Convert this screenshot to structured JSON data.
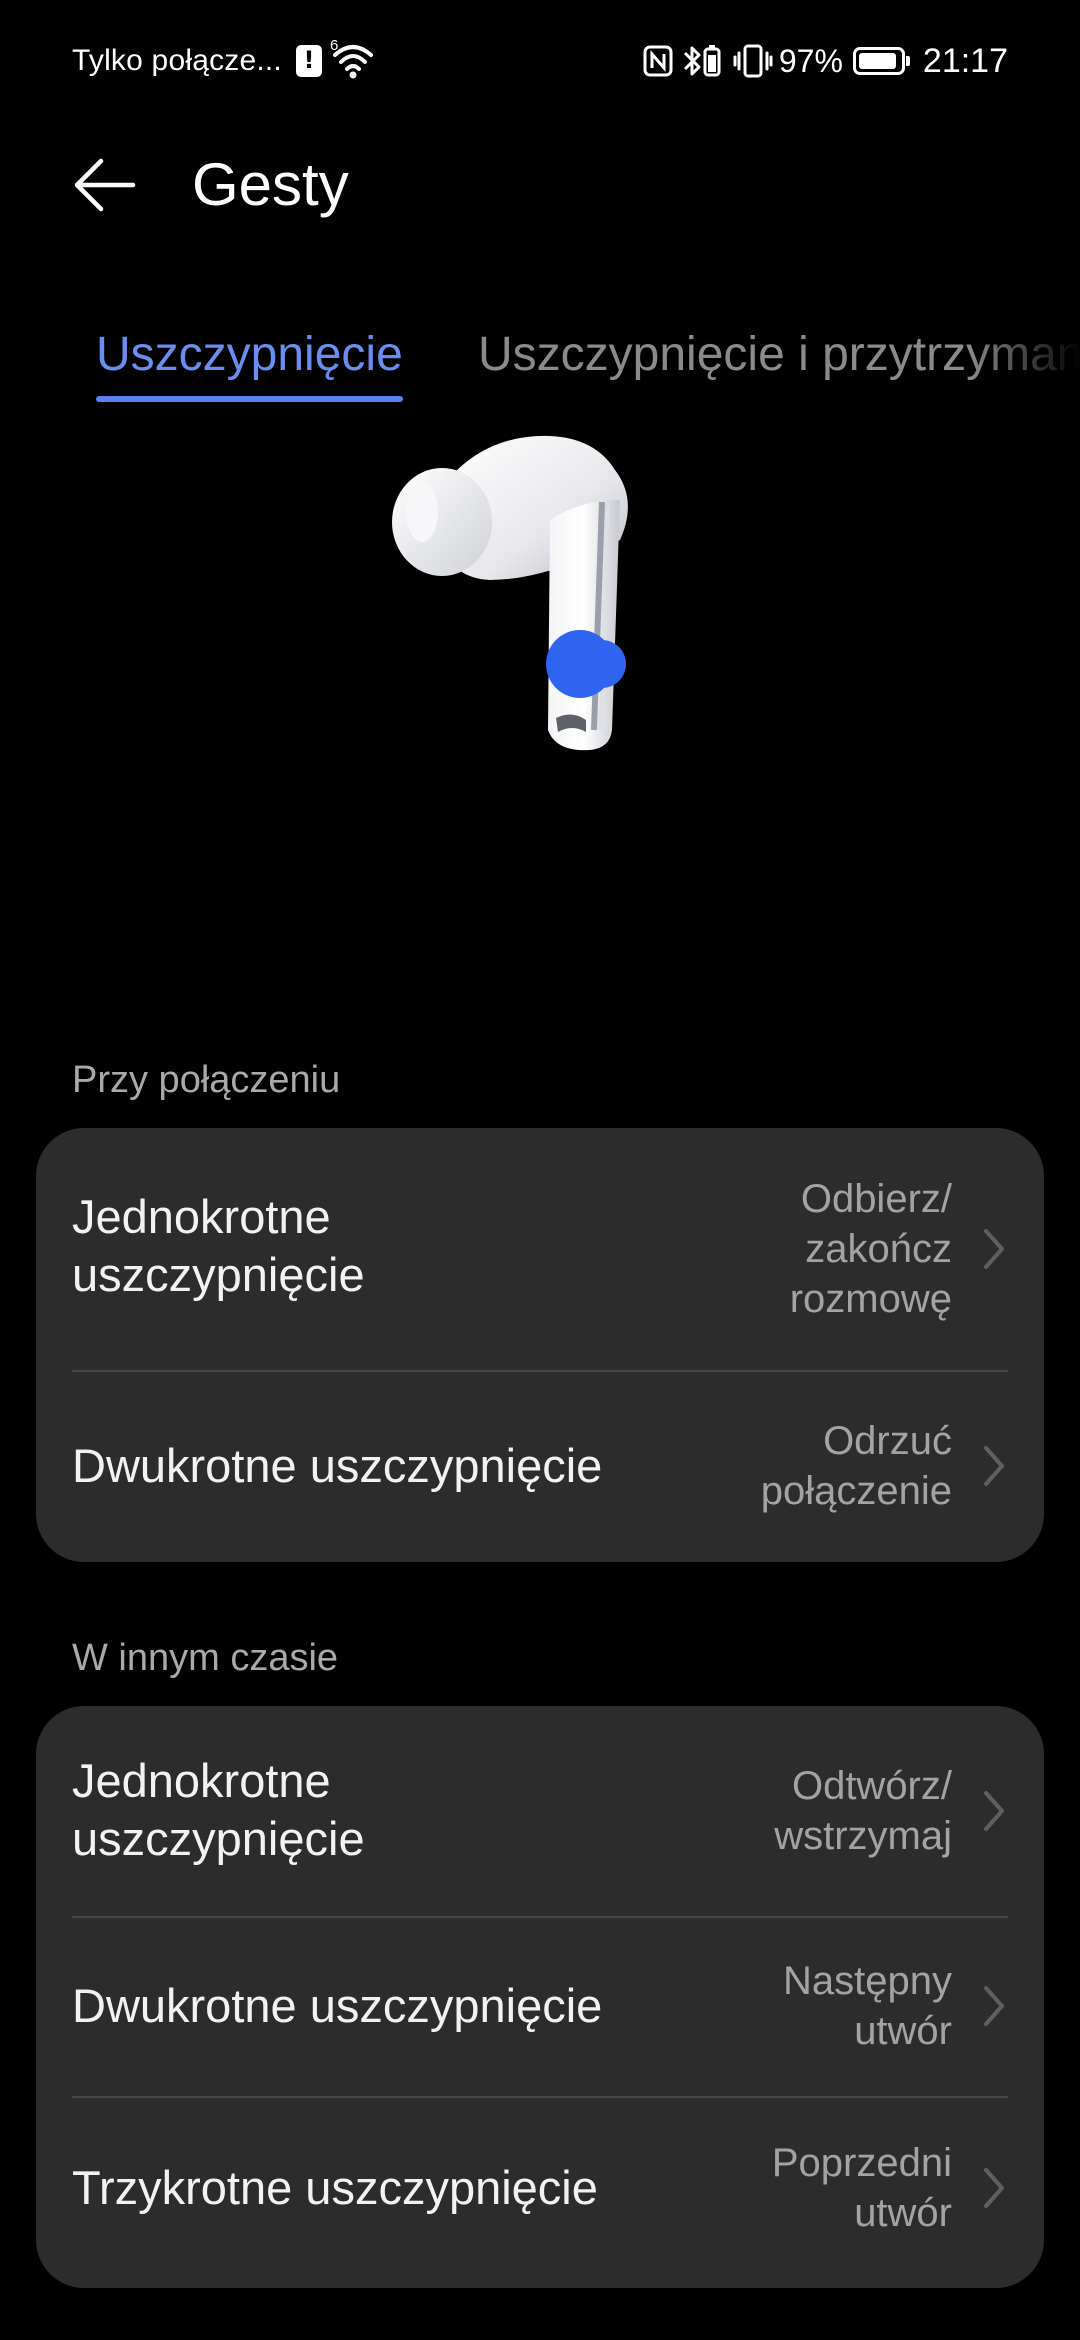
{
  "status_bar": {
    "carrier": "Tylko połącze...",
    "wifi_label": "6",
    "battery_percent": "97%",
    "time": "21:17",
    "icons": [
      "alert-icon",
      "wifi-icon",
      "nfc-icon",
      "bluetooth-battery-icon",
      "vibrate-icon",
      "battery-icon"
    ]
  },
  "header": {
    "title": "Gesty",
    "back_icon": "arrow-left-icon"
  },
  "tabs": [
    {
      "label": "Uszczypnięcie",
      "active": true
    },
    {
      "label": "Uszczypnięcie i przytrzymanie",
      "active": false
    }
  ],
  "illustration": {
    "name": "earbud-image",
    "marker_color": "#2f64f0"
  },
  "sections": [
    {
      "title": "Przy połączeniu",
      "rows": [
        {
          "label_lines": [
            "Jednokrotne",
            "uszczypnięcie"
          ],
          "value_lines": [
            "Odbierz/",
            "zakończ",
            "rozmowę"
          ]
        },
        {
          "label_lines": [
            "Dwukrotne uszczypnięcie"
          ],
          "value_lines": [
            "Odrzuć",
            "połączenie"
          ]
        }
      ]
    },
    {
      "title": "W innym czasie",
      "rows": [
        {
          "label_lines": [
            "Jednokrotne",
            "uszczypnięcie"
          ],
          "value_lines": [
            "Odtwórz/",
            "wstrzymaj"
          ]
        },
        {
          "label_lines": [
            "Dwukrotne uszczypnięcie"
          ],
          "value_lines": [
            "Następny",
            "utwór"
          ]
        },
        {
          "label_lines": [
            "Trzykrotne uszczypnięcie"
          ],
          "value_lines": [
            "Poprzedni",
            "utwór"
          ]
        }
      ]
    }
  ],
  "colors": {
    "accent": "#6c8df0",
    "card_bg": "#2c2c2c",
    "secondary_text": "#a3a3a3"
  }
}
